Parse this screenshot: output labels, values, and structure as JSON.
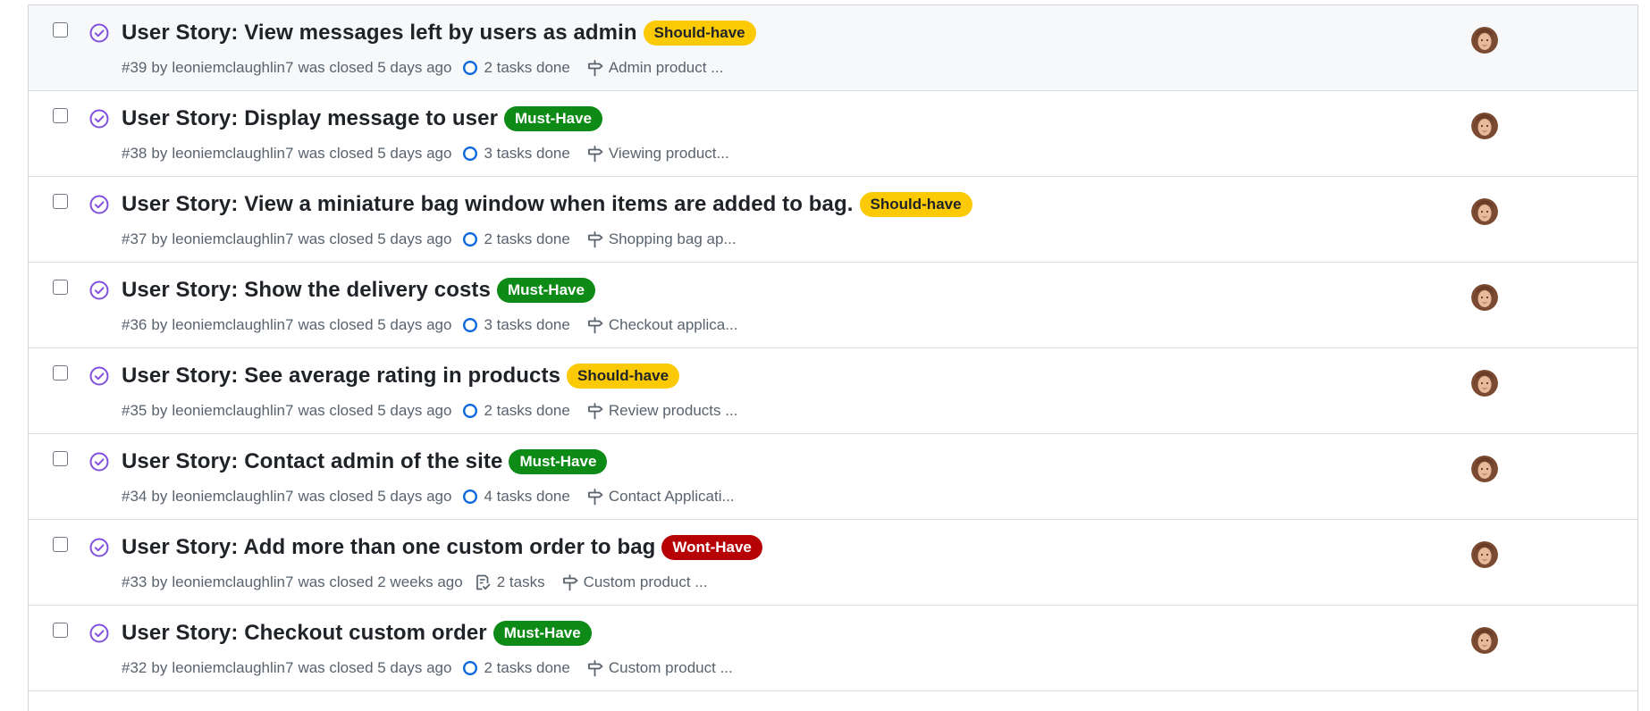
{
  "colors": {
    "closed_purple": "#8250df",
    "task_blue": "#0969da",
    "should_have_bg": "#fbca04",
    "should_have_fg": "#1f2328",
    "must_have_bg": "#0e8a16",
    "must_have_fg": "#ffffff",
    "wont_have_bg": "#b60205",
    "wont_have_fg": "#ffffff"
  },
  "issues": [
    {
      "title": "User Story: View messages left by users as admin",
      "label": "Should-have",
      "label_type": "should",
      "number": "#39",
      "by": "by",
      "author": "leoniemclaughlin7",
      "closed": "was closed 5 days ago",
      "tasks": "2 tasks done",
      "tasks_icon": "progress-circle-icon",
      "milestone": "Admin product ..."
    },
    {
      "title": "User Story: Display message to user",
      "label": "Must-Have",
      "label_type": "must",
      "number": "#38",
      "by": "by",
      "author": "leoniemclaughlin7",
      "closed": "was closed 5 days ago",
      "tasks": "3 tasks done",
      "tasks_icon": "progress-circle-icon",
      "milestone": "Viewing product..."
    },
    {
      "title": "User Story: View a miniature bag window when items are added to bag.",
      "label": "Should-have",
      "label_type": "should",
      "number": "#37",
      "by": "by",
      "author": "leoniemclaughlin7",
      "closed": "was closed 5 days ago",
      "tasks": "2 tasks done",
      "tasks_icon": "progress-circle-icon",
      "milestone": "Shopping bag ap..."
    },
    {
      "title": "User Story: Show the delivery costs",
      "label": "Must-Have",
      "label_type": "must",
      "number": "#36",
      "by": "by",
      "author": "leoniemclaughlin7",
      "closed": "was closed 5 days ago",
      "tasks": "3 tasks done",
      "tasks_icon": "progress-circle-icon",
      "milestone": "Checkout applica..."
    },
    {
      "title": "User Story: See average rating in products",
      "label": "Should-have",
      "label_type": "should",
      "number": "#35",
      "by": "by",
      "author": "leoniemclaughlin7",
      "closed": "was closed 5 days ago",
      "tasks": "2 tasks done",
      "tasks_icon": "progress-circle-icon",
      "milestone": "Review products ..."
    },
    {
      "title": "User Story: Contact admin of the site",
      "label": "Must-Have",
      "label_type": "must",
      "number": "#34",
      "by": "by",
      "author": "leoniemclaughlin7",
      "closed": "was closed 5 days ago",
      "tasks": "4 tasks done",
      "tasks_icon": "progress-circle-icon",
      "milestone": "Contact Applicati..."
    },
    {
      "title": "User Story: Add more than one custom order to bag",
      "label": "Wont-Have",
      "label_type": "wont",
      "number": "#33",
      "by": "by",
      "author": "leoniemclaughlin7",
      "closed": "was closed 2 weeks ago",
      "tasks": "2 tasks",
      "tasks_icon": "checklist-icon",
      "milestone": "Custom product ..."
    },
    {
      "title": "User Story: Checkout custom order",
      "label": "Must-Have",
      "label_type": "must",
      "number": "#32",
      "by": "by",
      "author": "leoniemclaughlin7",
      "closed": "was closed 5 days ago",
      "tasks": "2 tasks done",
      "tasks_icon": "progress-circle-icon",
      "milestone": "Custom product ..."
    }
  ]
}
